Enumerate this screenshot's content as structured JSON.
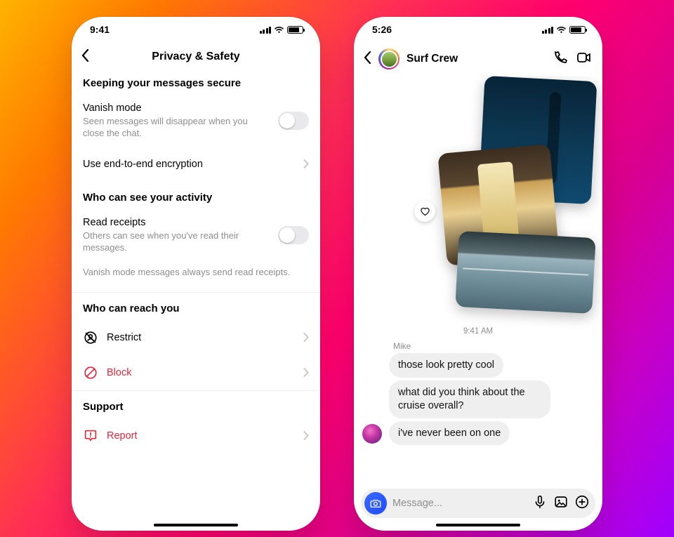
{
  "settings": {
    "status_time": "9:41",
    "nav_title": "Privacy & Safety",
    "sections": {
      "secure": {
        "heading": "Keeping your messages secure",
        "vanish": {
          "title": "Vanish mode",
          "desc": "Seen messages will disappear when you close the chat.",
          "on": false
        },
        "e2ee": {
          "title": "Use end-to-end encryption"
        }
      },
      "activity": {
        "heading": "Who can see your activity",
        "read_receipts": {
          "title": "Read receipts",
          "desc": "Others can see when you've read their messages.",
          "on": false
        },
        "footnote": "Vanish mode messages always send read receipts."
      },
      "reach": {
        "heading": "Who can reach you",
        "restrict": "Restrict",
        "block": "Block"
      },
      "support": {
        "heading": "Support",
        "report": "Report"
      }
    }
  },
  "chat": {
    "status_time": "5:26",
    "thread_title": "Surf Crew",
    "timestamp": "9:41 AM",
    "sender_name": "Mike",
    "messages": {
      "m1": "those look pretty cool",
      "m2": "what did you think about the cruise overall?",
      "m3": "i've never been on one"
    },
    "composer_placeholder": "Message..."
  }
}
